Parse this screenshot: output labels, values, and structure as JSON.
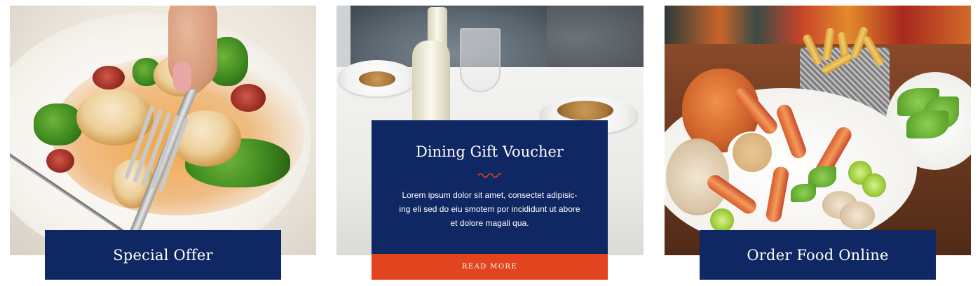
{
  "cards": [
    {
      "title": "Special Offer"
    },
    {
      "title": "Dining Gift Voucher",
      "description": "Lorem ipsum dolor sit amet, consectet adipisic-ing eli sed do eiu smotem por incididunt ut abore et dolore magali qua.",
      "button_label": "READ MORE"
    },
    {
      "title": "Order Food Online"
    }
  ],
  "colors": {
    "navy": "#0f2762",
    "accent": "#e1441e",
    "text": "#ffffff"
  }
}
